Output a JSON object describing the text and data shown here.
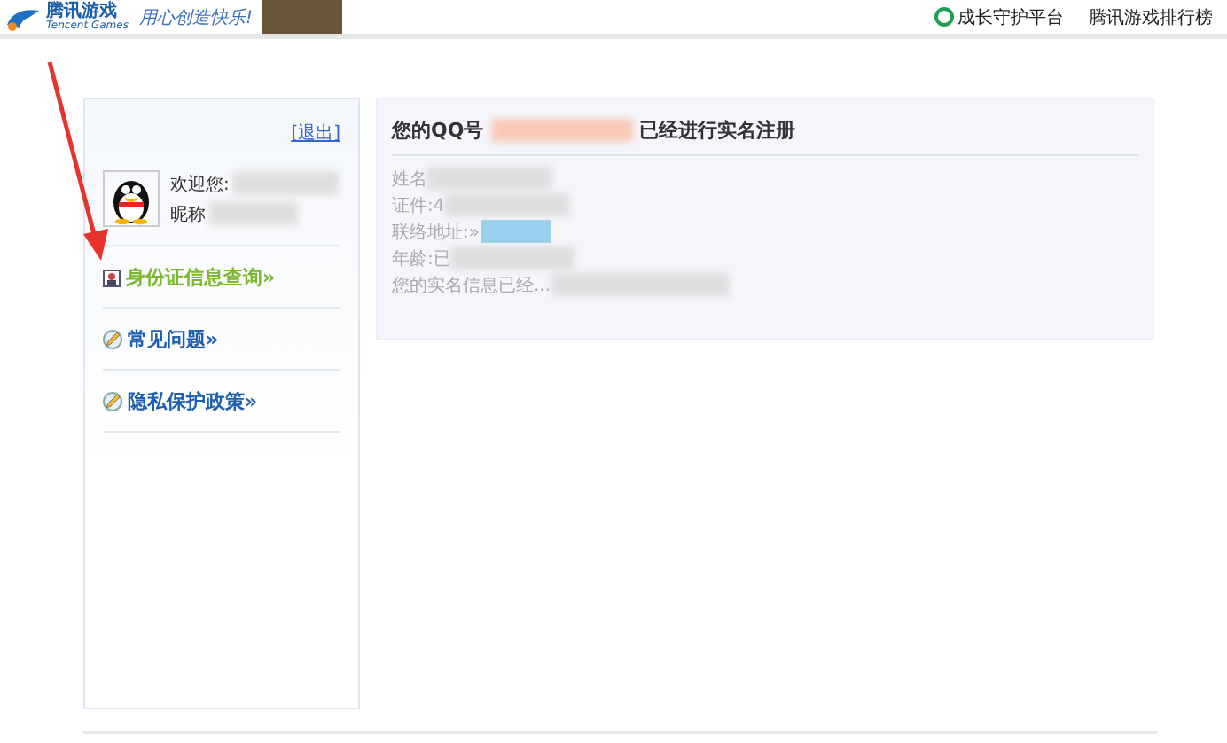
{
  "header": {
    "logo_title": "腾讯游戏",
    "logo_subtitle": "Tencent Games",
    "slogan": "用心创造快乐!",
    "links": [
      {
        "label": "成长守护平台",
        "kind": "guard"
      },
      {
        "label": "腾讯游戏排行榜",
        "kind": "plain"
      }
    ]
  },
  "sidebar": {
    "logout": "[退出]",
    "welcome": "欢迎您:",
    "nickname": "昵称",
    "items": [
      {
        "label": "身份证信息查询»",
        "kind": "id",
        "selected": true
      },
      {
        "label": "常见问题»",
        "kind": "pencil",
        "selected": false
      },
      {
        "label": "隐私保护政策»",
        "kind": "pencil",
        "selected": false
      }
    ]
  },
  "main": {
    "title_prefix": "您的QQ号",
    "title_suffix": "已经进行实名注册",
    "lines": [
      "姓名",
      "证件:4",
      "联络地址:»",
      "年龄:已",
      "您的实名信息已经..."
    ]
  }
}
